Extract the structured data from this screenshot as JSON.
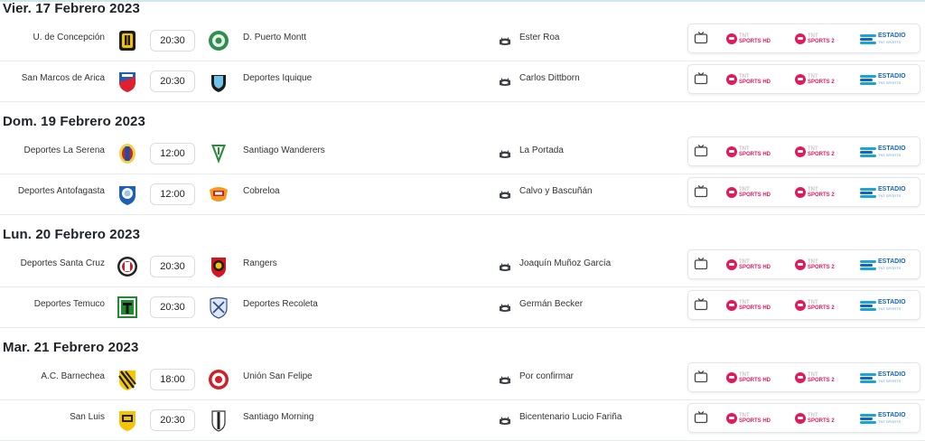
{
  "days": [
    {
      "date": "Vier. 17 Febrero 2023",
      "matches": [
        {
          "home": "U. de Concepción",
          "time": "20:30",
          "away": "D. Puerto Montt",
          "stadium": "Ester Roa"
        },
        {
          "home": "San Marcos de Arica",
          "time": "20:30",
          "away": "Deportes Iquique",
          "stadium": "Carlos Dittborn"
        }
      ]
    },
    {
      "date": "Dom. 19 Febrero 2023",
      "matches": [
        {
          "home": "Deportes La Serena",
          "time": "12:00",
          "away": "Santiago Wanderers",
          "stadium": "La Portada"
        },
        {
          "home": "Deportes Antofagasta",
          "time": "12:00",
          "away": "Cobreloa",
          "stadium": "Calvo y Bascuñán"
        }
      ]
    },
    {
      "date": "Lun. 20 Febrero 2023",
      "matches": [
        {
          "home": "Deportes Santa Cruz",
          "time": "20:30",
          "away": "Rangers",
          "stadium": "Joaquín Muñoz García"
        },
        {
          "home": "Deportes Temuco",
          "time": "20:30",
          "away": "Deportes Recoleta",
          "stadium": "Germán Becker"
        }
      ]
    },
    {
      "date": "Mar. 21 Febrero 2023",
      "matches": [
        {
          "home": "A.C. Barnechea",
          "time": "18:00",
          "away": "Unión San Felipe",
          "stadium": "Por confirmar"
        },
        {
          "home": "San Luis",
          "time": "20:30",
          "away": "Santiago Morning",
          "stadium": "Bicentenario Lucio Fariña"
        }
      ]
    }
  ],
  "broadcast": {
    "tv_icon": "tv-icon",
    "channels": [
      {
        "top": "TNT",
        "bottom": "SPORTS HD"
      },
      {
        "top": "TNT",
        "bottom": "SPORTS 2"
      },
      {
        "top": "ESTADIO",
        "bottom": "TNT SPORTS"
      }
    ]
  },
  "colors": {
    "tnt_pink": "#e2195b",
    "estadio_blue": "#1565c0",
    "divider": "#e9ecef"
  }
}
